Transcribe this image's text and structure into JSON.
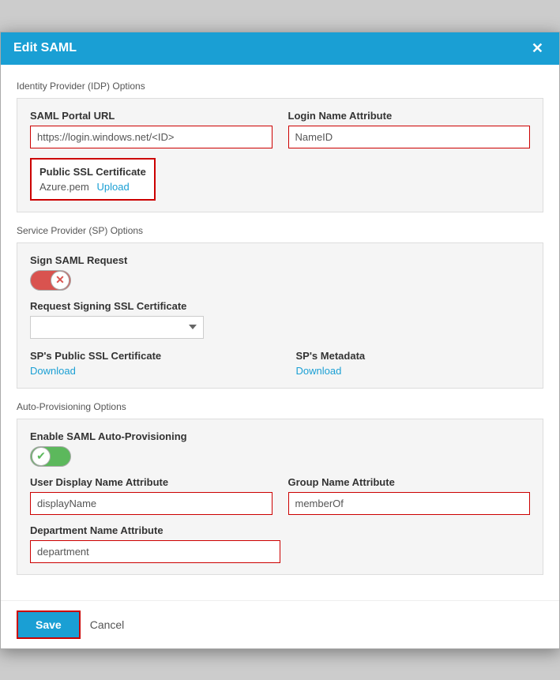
{
  "modal": {
    "title": "Edit SAML",
    "close_label": "✕"
  },
  "idp_section": {
    "label": "Identity Provider (IDP) Options",
    "saml_url_label": "SAML Portal URL",
    "saml_url_value": "https://login.windows.net/<ID>",
    "login_name_label": "Login Name Attribute",
    "login_name_value": "NameID",
    "cert_label": "Public SSL Certificate",
    "cert_filename": "Azure.pem",
    "upload_label": "Upload"
  },
  "sp_section": {
    "label": "Service Provider (SP) Options",
    "sign_saml_label": "Sign SAML Request",
    "toggle_off_state": "off",
    "toggle_off_icon": "✕",
    "signing_cert_label": "Request Signing SSL Certificate",
    "signing_cert_placeholder": "",
    "public_cert_label": "SP's Public SSL Certificate",
    "public_cert_download": "Download",
    "metadata_label": "SP's Metadata",
    "metadata_download": "Download"
  },
  "auto_prov_section": {
    "label": "Auto-Provisioning Options",
    "enable_label": "Enable SAML Auto-Provisioning",
    "toggle_on_state": "on",
    "toggle_on_icon": "✔",
    "user_display_label": "User Display Name Attribute",
    "user_display_value": "displayName",
    "group_name_label": "Group Name Attribute",
    "group_name_value": "memberOf",
    "dept_name_label": "Department Name Attribute",
    "dept_name_value": "department"
  },
  "footer": {
    "save_label": "Save",
    "cancel_label": "Cancel"
  }
}
